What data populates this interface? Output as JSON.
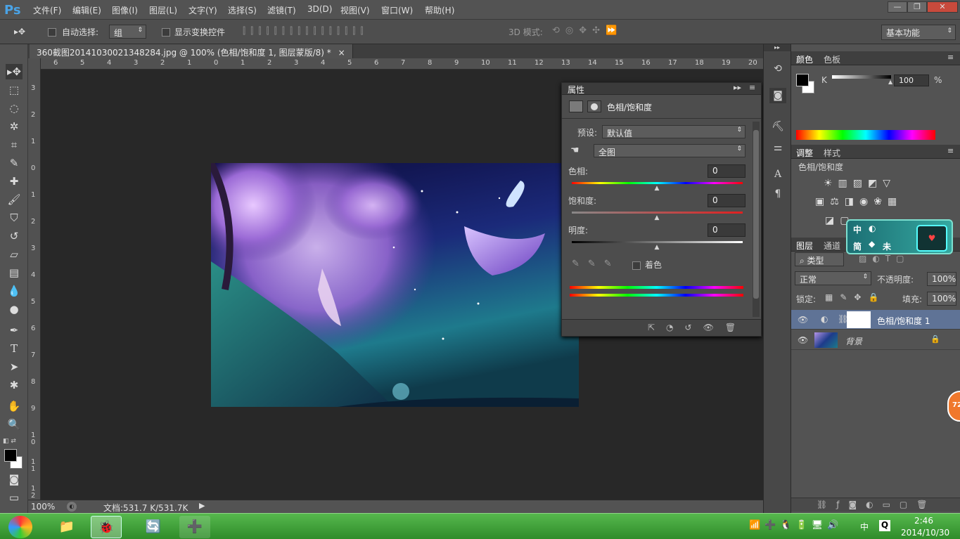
{
  "app": {
    "logo": "Ps",
    "menus": [
      "文件(F)",
      "编辑(E)",
      "图像(I)",
      "图层(L)",
      "文字(Y)",
      "选择(S)",
      "滤镜(T)",
      "3D(D)",
      "视图(V)",
      "窗口(W)",
      "帮助(H)"
    ],
    "window_buttons": [
      "—",
      "❐",
      "✕"
    ]
  },
  "options": {
    "auto_select_label": "自动选择:",
    "auto_select_value": "组",
    "show_transform_label": "显示变换控件",
    "mode_3d_label": "3D 模式:",
    "workspace": "基本功能"
  },
  "document": {
    "tab_title": "360截图20141030021348284.jpg @ 100% (色相/饱和度 1, 图层蒙版/8) *",
    "tab_close": "×",
    "hruler_ticks": [
      "6",
      "5",
      "4",
      "3",
      "2",
      "1",
      "0",
      "1",
      "2",
      "3",
      "4",
      "5",
      "6",
      "7",
      "8",
      "9",
      "10",
      "11",
      "12",
      "13",
      "14",
      "15",
      "16",
      "17",
      "18",
      "19",
      "20"
    ],
    "vruler_ticks": [
      "3",
      "2",
      "1",
      "0",
      "1",
      "2",
      "3",
      "4",
      "5",
      "6",
      "7",
      "8",
      "9",
      "1 0",
      "1 1",
      "1 2"
    ]
  },
  "status": {
    "zoom": "100%",
    "doc_info": "文档:531.7 K/531.7K"
  },
  "properties": {
    "title": "属性",
    "adj_name": "色相/饱和度",
    "preset_label": "预设:",
    "preset_value": "默认值",
    "channel_value": "全图",
    "hue_label": "色相:",
    "hue_value": "0",
    "sat_label": "饱和度:",
    "sat_value": "0",
    "light_label": "明度:",
    "light_value": "0",
    "colorize_label": "着色",
    "hue_slider": 0.5,
    "sat_slider": 0.5,
    "light_slider": 0.5
  },
  "color_panel": {
    "tabs": [
      "颜色",
      "色板"
    ],
    "channel": "K",
    "value": "100",
    "unit": "%",
    "k_slider": 1.0,
    "fg": "#000000",
    "bg": "#ffffff"
  },
  "adjust_panel": {
    "tabs": [
      "调整",
      "样式"
    ],
    "current": "色相/饱和度"
  },
  "layers_panel": {
    "tabs": [
      "图层",
      "通道"
    ],
    "filter": "类型",
    "blend": "正常",
    "opacity_label": "不透明度:",
    "opacity": "100%",
    "lock_label": "锁定:",
    "fill_label": "填充:",
    "fill": "100%",
    "layers": [
      {
        "name": "色相/饱和度 1",
        "type": "adjustment"
      },
      {
        "name": "背景",
        "type": "image"
      }
    ]
  },
  "ime": {
    "text1": "中",
    "text2": "简",
    "text3": "未"
  },
  "badge": "72",
  "taskbar": {
    "time": "2:46",
    "date": "2014/10/30",
    "tray_lang": "中"
  }
}
